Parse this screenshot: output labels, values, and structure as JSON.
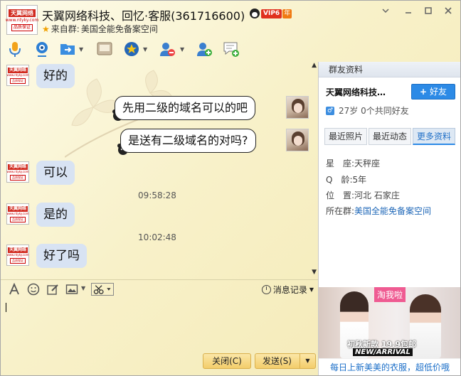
{
  "window": {
    "title": "天翼网络科技、回忆·客服(361716600)",
    "vip_label": "VIP6",
    "vip_year_label": "年",
    "source_prefix": "来自群:",
    "source_group": "美国全能免备案空间",
    "controls": [
      "chevron-down",
      "minimize",
      "maximize",
      "close"
    ]
  },
  "logo": {
    "name": "天翼网络",
    "url": "www.ntyky.com",
    "tag": "品质保证"
  },
  "toolbar": {
    "icons": [
      "microphone-icon",
      "video-call-icon",
      "send-file-icon",
      "screen-share-icon",
      "app-center-icon",
      "remove-friend-icon",
      "add-friend-icon",
      "message-add-icon"
    ]
  },
  "chat": {
    "messages": [
      {
        "side": "left",
        "text": "好的"
      },
      {
        "side": "right",
        "text": "先用二级的域名可以的吧"
      },
      {
        "side": "right",
        "text": "是送有二级域名的对吗?"
      },
      {
        "side": "left",
        "text": "可以"
      },
      {
        "time": "09:58:28"
      },
      {
        "side": "left",
        "text": "是的"
      },
      {
        "time": "10:02:48"
      },
      {
        "side": "left",
        "text": "好了吗"
      }
    ]
  },
  "input_toolbar": {
    "icons": [
      "font-icon",
      "emoji-icon",
      "edit-image-icon",
      "picture-icon",
      "scissors-icon"
    ],
    "history_label": "消息记录"
  },
  "buttons": {
    "close_label": "关闭(C)",
    "send_label": "发送(S)"
  },
  "panel": {
    "header": "群友资料",
    "group_member_name": "天翼网络科技…",
    "add_friend_label": "好友",
    "profile_line": "27岁  0个共同好友",
    "tabs": [
      "最近照片",
      "最近动态",
      "更多资料"
    ],
    "active_tab": "更多资料",
    "info": [
      {
        "label": "星　座:",
        "value": "天秤座"
      },
      {
        "label": "Q　龄:",
        "value": "5年"
      },
      {
        "label": "位　置:",
        "value": "河北 石家庄"
      },
      {
        "label": "所在群:",
        "value": "美国全能免备案空间"
      }
    ],
    "ad": {
      "tag": "淘我啦",
      "line1": "初秋新款 19.9包邮",
      "line2": "NEW/ARRIVAL",
      "caption": "每日上新美美的衣服，超低价哦"
    }
  }
}
